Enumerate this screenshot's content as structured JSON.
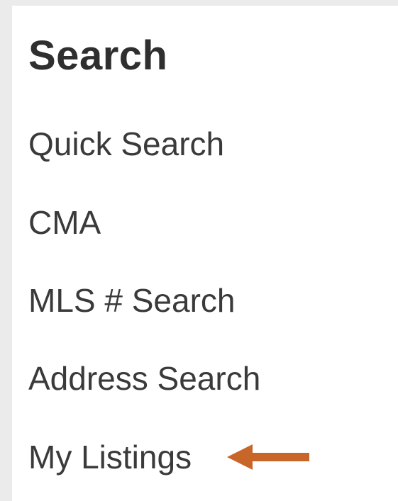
{
  "menu": {
    "title": "Search",
    "items": [
      {
        "label": "Quick Search"
      },
      {
        "label": "CMA"
      },
      {
        "label": "MLS # Search"
      },
      {
        "label": "Address Search"
      },
      {
        "label": "My Listings"
      }
    ]
  },
  "annotation": {
    "icon": "left-arrow-icon",
    "color": "#c8662a",
    "points_to": "My Listings"
  }
}
